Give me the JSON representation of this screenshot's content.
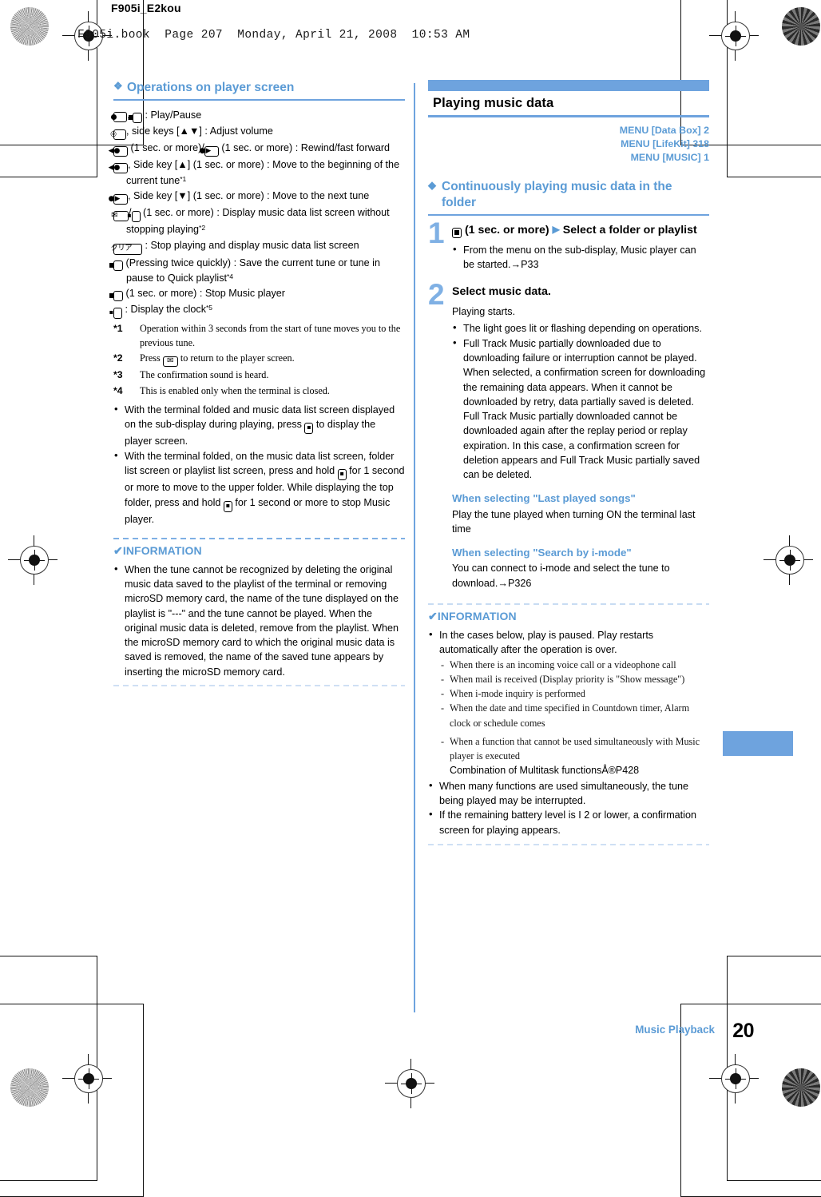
{
  "page": {
    "doc_header": "F905i_E2kou",
    "book_line": "F905i.book  Page 207  Monday, April 21, 2008  10:53 AM",
    "footer_chapter": "Music Playback",
    "footer_page": "20",
    "accent_color": "#6ea3de",
    "heading_color": "#5b9bd5"
  },
  "left_column": {
    "heading": {
      "glyph": "❖",
      "text": "Operations on player screen"
    },
    "operations": [
      {
        "keys": [
          "center-key",
          "music-key"
        ],
        "sep": ", ",
        "text": ": Play/Pause"
      },
      {
        "keys": [
          "nav-key"
        ],
        "text": ", side keys [▲▼] : Adjust volume"
      },
      {
        "keys": [
          "left-key"
        ],
        "text": " (1 sec. or more)/",
        "key2": "right-key",
        "text2": " (1 sec. or more) : Rewind/fast forward"
      },
      {
        "keys": [
          "left-key"
        ],
        "text": ", Side key [▲] (1 sec. or more) : Move to the beginning of the current tune",
        "sup": "*1"
      },
      {
        "keys": [
          "right-key"
        ],
        "text": ", Side key [▼] (1 sec. or more) : Move to the next tune"
      },
      {
        "keys": [
          "mail-key"
        ],
        "text": "/",
        "key2": "side-key",
        "text2": " (1 sec. or more) : Display music data list screen without stopping playing",
        "sup": "*2"
      },
      {
        "keys": [
          "clear-key"
        ],
        "text": " : Stop playing and display music data list screen"
      },
      {
        "keys": [
          "music-key"
        ],
        "text": " (Pressing twice quickly) : Save the current tune or tune in pause to Quick playlist",
        "sup": "*4"
      },
      {
        "keys": [
          "music-key"
        ],
        "text": " (1 sec. or more) : Stop Music player"
      },
      {
        "keys": [
          "side-key"
        ],
        "text": " : Display the clock",
        "sup": "*5"
      }
    ],
    "footnotes": [
      {
        "mark": "*1",
        "text": "Operation within 3 seconds from the start of tune moves you to the previous tune."
      },
      {
        "mark": "*2",
        "text_before": "Press ",
        "key": "mail-key",
        "text_after": " to return to the player screen."
      },
      {
        "mark": "*3",
        "text": "The confirmation sound is heard."
      },
      {
        "mark": "*4",
        "text": "This is enabled only when the terminal is closed."
      }
    ],
    "bullets": [
      {
        "parts": [
          "With the terminal folded and music data list screen displayed on the sub-display during playing, press ",
          "side-key",
          " to display the player screen."
        ]
      },
      {
        "parts": [
          "With the terminal folded, on the music data list screen, folder list screen or playlist list screen, press and hold ",
          "side-key",
          " for 1 second or more to move to the upper folder. While displaying the top folder, press and hold ",
          "side-key",
          " for 1 second or more to stop Music player."
        ]
      }
    ],
    "information": {
      "title": "INFORMATION",
      "check_glyph": "✔",
      "bullets": [
        "When the tune cannot be recognized by deleting the original music data saved to the playlist of the terminal or removing microSD memory card, the name of the tune displayed on the playlist is \"---\" and the tune cannot be played. When the original music data is deleted, remove from the playlist. When the microSD memory card to which the original music data is saved is removed, the name of the saved tune appears by inserting the microSD memory card."
      ]
    }
  },
  "right_column": {
    "section_title": "Playing music data",
    "menu_paths": [
      "MENU [Data Box] 2",
      "MENU [LifeKit] 318",
      "MENU [MUSIC] 1"
    ],
    "heading": {
      "glyph": "◆",
      "text": "Continuously playing music data in the folder"
    },
    "steps": [
      {
        "num": "1",
        "head_key": "music-key",
        "head_text": " (1 sec. or more)",
        "head_arrow": "▶",
        "head_text2": " Select a folder or playlist",
        "bullets": [
          "From the menu on the sub-display, Music player can be started.→P33"
        ]
      },
      {
        "num": "2",
        "head_text2": "Select music data.",
        "intro": "Playing starts.",
        "bullets": [
          "The light goes lit or flashing depending on operations.",
          "Full Track Music partially downloaded due to downloading failure or interruption cannot be played. When selected, a confirmation screen for downloading the remaining data appears. When it cannot be downloaded by retry, data partially saved is deleted.\nFull Track Music partially downloaded cannot be downloaded again after the replay period or replay expiration. In this case, a confirmation screen for deletion appears and  Full Track Music partially saved can be deleted."
        ],
        "subsections": [
          {
            "title": "When selecting \"Last played songs\"",
            "body": "Play the tune played when turning ON the terminal last time"
          },
          {
            "title": "When selecting \"Search by i-mode\"",
            "body": "You can connect to i-mode and select the tune to download.→P326"
          }
        ]
      }
    ],
    "information": {
      "title": "INFORMATION",
      "check_glyph": "✔",
      "bullets": [
        "In the cases below, play is paused. Play restarts automatically after the operation is over."
      ],
      "dash_items": [
        "When there is an incoming voice call or a videophone call",
        "When mail is received (Display priority is \"Show message\")",
        "When i-mode inquiry is performed",
        "When the date and time specified in Countdown timer, Alarm clock or schedule comes",
        "When a function that cannot be used simultaneously with Music player is executed"
      ],
      "dash_sub": "Combination of Multitask functionsÅ®P428",
      "bullets_after": [
        "When many functions are used simultaneously, the tune being played may be interrupted.",
        "If the remaining battery level is I 2 or lower, a confirmation screen for playing appears."
      ]
    }
  }
}
